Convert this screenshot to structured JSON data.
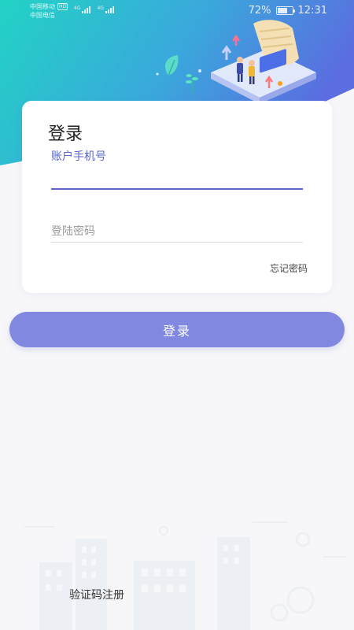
{
  "status_bar": {
    "carrier_1": "中国移动",
    "carrier_1_badge": "HD",
    "carrier_2": "中国电信",
    "network_1": "4G",
    "network_2": "4G",
    "battery_percent": "72%",
    "battery_level": 0.72,
    "time": "12:31"
  },
  "login_card": {
    "title": "登录",
    "phone_label": "账户手机号",
    "phone_value": "",
    "password_placeholder": "登陆密码",
    "password_value": "",
    "forgot_label": "忘记密码"
  },
  "login_button": {
    "label": "登录"
  },
  "footer": {
    "register_label": "验证码注册"
  },
  "colors": {
    "accent": "#5a67c8",
    "button": "#8188e0",
    "header_gradient_start": "#22d3c5",
    "header_gradient_end": "#5b6de0",
    "background": "#f7f7f9"
  }
}
